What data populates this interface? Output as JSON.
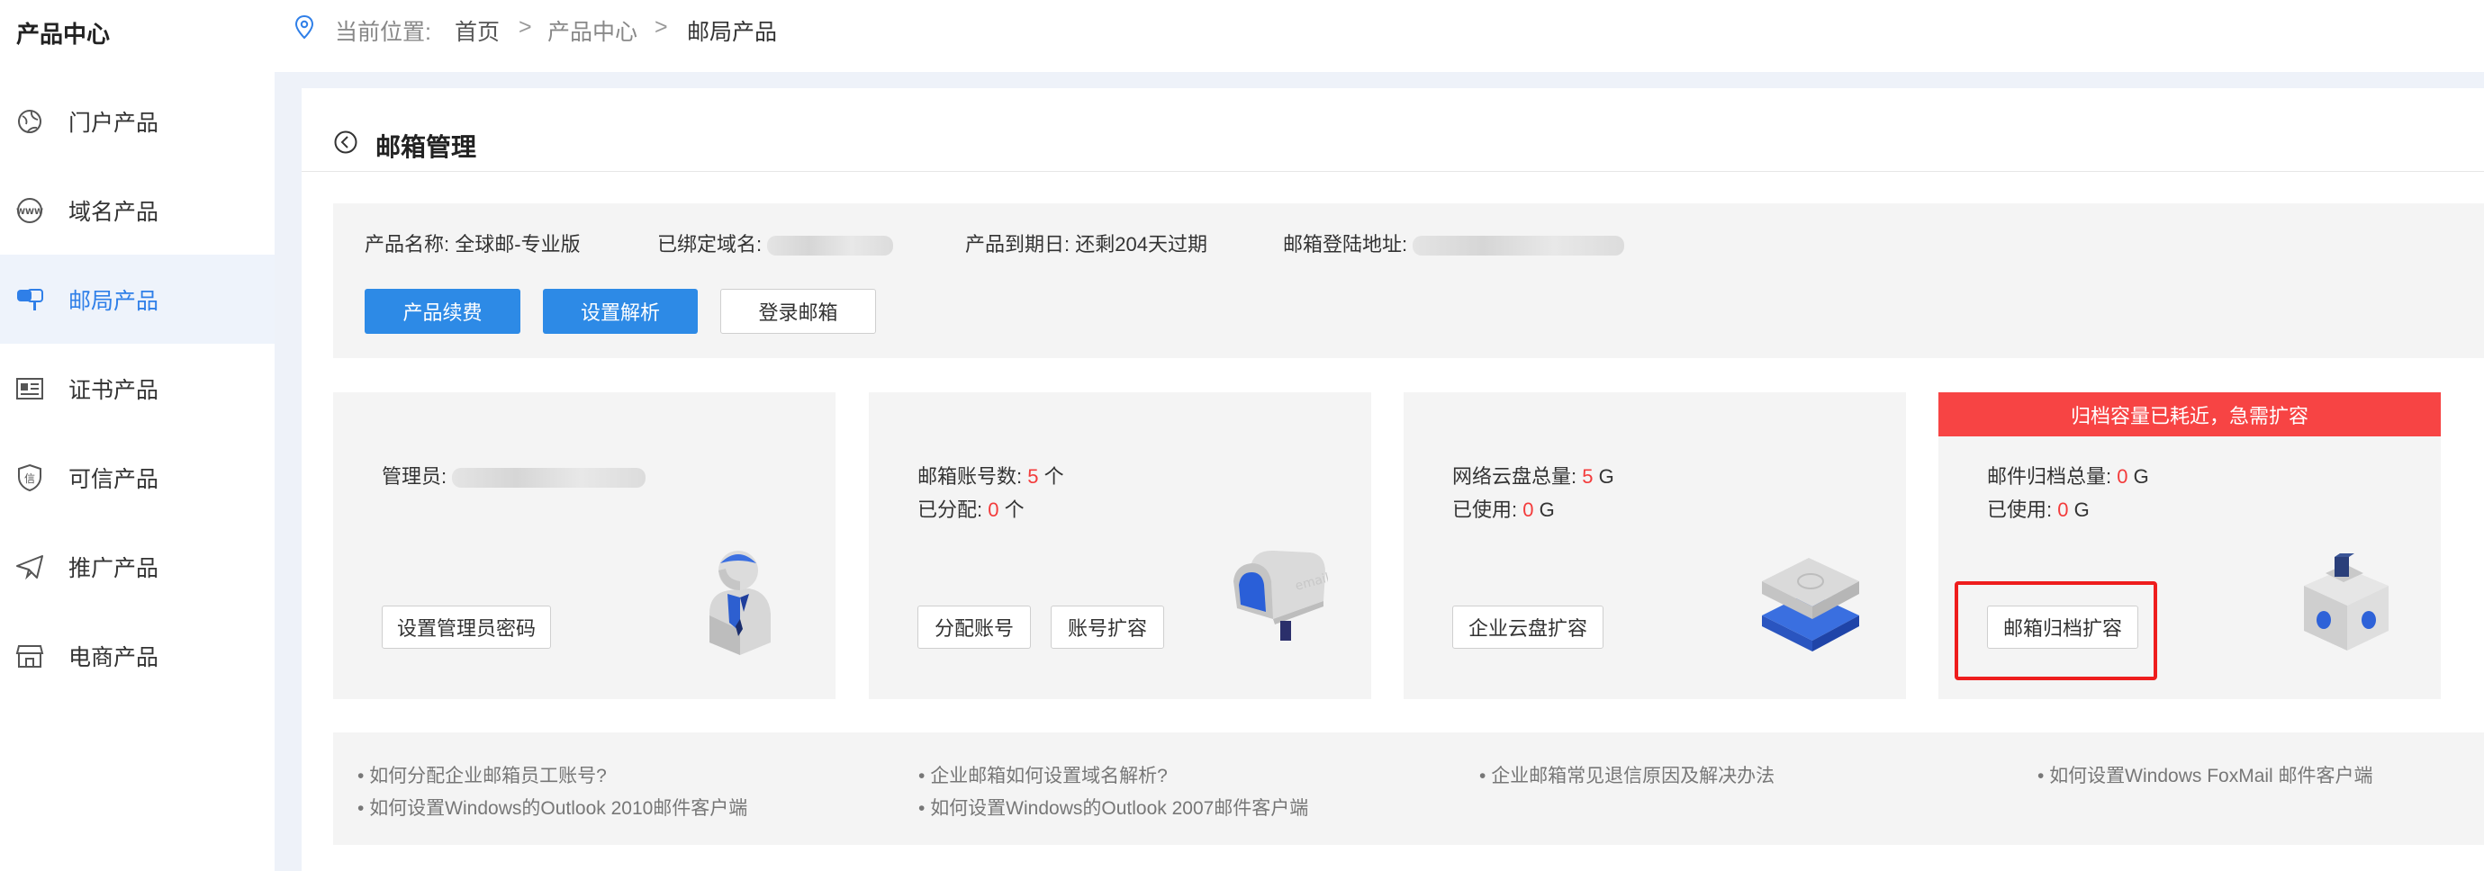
{
  "sidebar": {
    "title": "产品中心",
    "items": [
      {
        "label": "门户产品",
        "icon": "globe-icon"
      },
      {
        "label": "域名产品",
        "icon": "www-icon"
      },
      {
        "label": "邮局产品",
        "icon": "mailbox-icon"
      },
      {
        "label": "证书产品",
        "icon": "certificate-icon"
      },
      {
        "label": "可信产品",
        "icon": "shield-icon"
      },
      {
        "label": "推广产品",
        "icon": "paper-plane-icon"
      },
      {
        "label": "电商产品",
        "icon": "shop-icon"
      }
    ],
    "active_index": 2
  },
  "breadcrumb": {
    "prefix": "当前位置:",
    "items": [
      "首页",
      "产品中心",
      "邮局产品"
    ],
    "separator": ">"
  },
  "page": {
    "title": "邮箱管理"
  },
  "product_info": {
    "name_label": "产品名称:",
    "name_value": "全球邮-专业版",
    "domain_label": "已绑定域名:",
    "expire_label": "产品到期日:",
    "expire_value": "还剩204天过期",
    "login_label": "邮箱登陆地址:",
    "buttons": [
      "产品续费",
      "设置解析",
      "登录邮箱"
    ]
  },
  "cards": {
    "admin": {
      "label": "管理员:",
      "button": "设置管理员密码"
    },
    "accounts": {
      "count_label": "邮箱账号数:",
      "count_value": "5",
      "count_unit": "个",
      "assigned_label": "已分配:",
      "assigned_value": "0",
      "assigned_unit": "个",
      "buttons": [
        "分配账号",
        "账号扩容"
      ]
    },
    "cloud": {
      "total_label": "网络云盘总量:",
      "total_value": "5",
      "total_unit": "G",
      "used_label": "已使用:",
      "used_value": "0",
      "used_unit": "G",
      "button": "企业云盘扩容"
    },
    "archive": {
      "alert": "归档容量已耗近，急需扩容",
      "total_label": "邮件归档总量:",
      "total_value": "0",
      "total_unit": "G",
      "used_label": "已使用:",
      "used_value": "0",
      "used_unit": "G",
      "button": "邮箱归档扩容"
    }
  },
  "faq": {
    "col1": [
      "如何分配企业邮箱员工账号?",
      "如何设置Windows的Outlook 2010邮件客户端"
    ],
    "col2": [
      "企业邮箱如何设置域名解析?",
      "如何设置Windows的Outlook 2007邮件客户端"
    ],
    "col3": [
      "企业邮箱常见退信原因及解决办法"
    ],
    "col4": [
      "如何设置Windows FoxMail 邮件客户端"
    ]
  },
  "colors": {
    "accent": "#2d8ae6",
    "alert": "#f74444",
    "value_red": "#f33b3b"
  }
}
